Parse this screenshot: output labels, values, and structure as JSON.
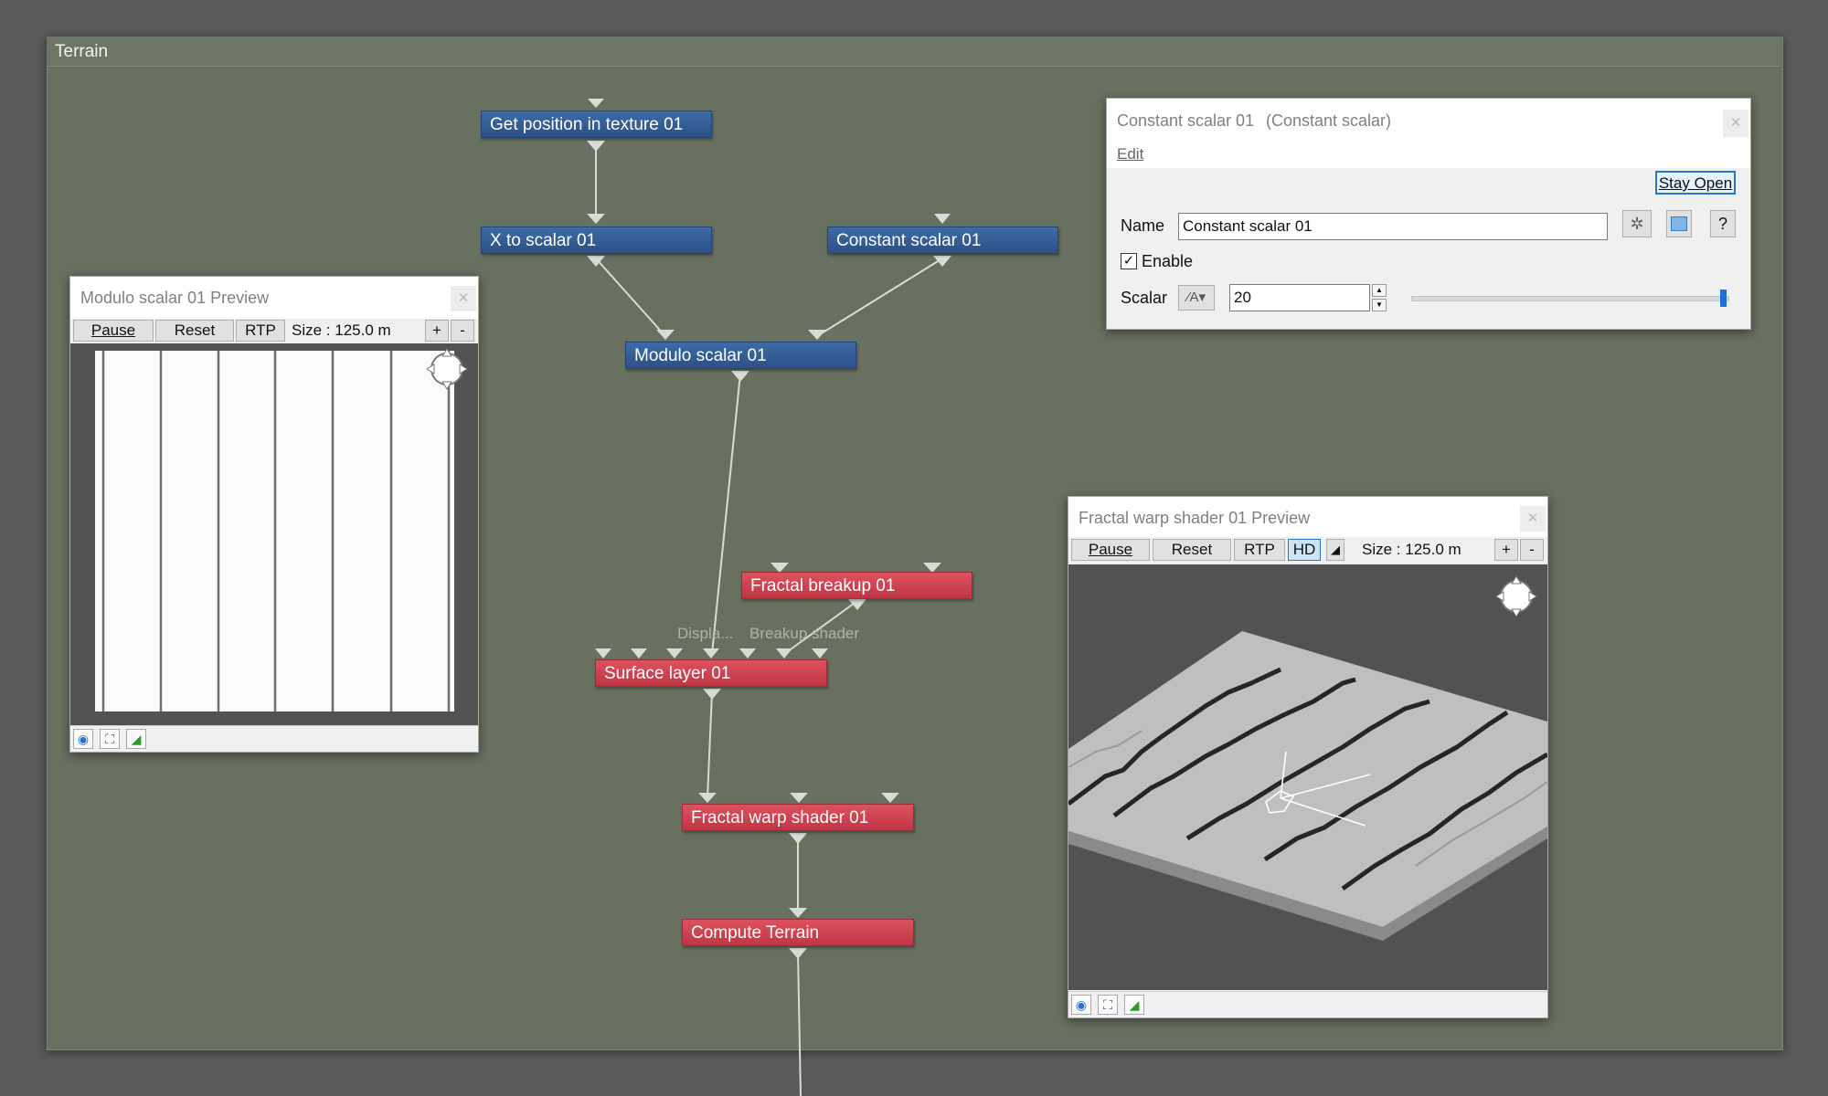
{
  "panel": {
    "title": "Terrain"
  },
  "nodes": {
    "get_position": "Get position in texture 01",
    "x_to_scalar": "X to scalar 01",
    "constant_scalar": "Constant scalar 01",
    "modulo_scalar": "Modulo scalar 01",
    "fractal_breakup": "Fractal breakup 01",
    "surface_layer": "Surface layer 01",
    "fractal_warp": "Fractal warp shader 01",
    "compute_terrain": "Compute Terrain"
  },
  "port_labels": {
    "displacement": "Displa...",
    "breakup_shader": "Breakup shader"
  },
  "modulo_preview": {
    "title": "Modulo scalar 01 Preview",
    "pause": "Pause",
    "reset": "Reset",
    "rtp": "RTP",
    "size_label": "Size : 125.0 m",
    "plus": "+",
    "minus": "-"
  },
  "fractal_preview": {
    "title": "Fractal warp shader 01 Preview",
    "pause": "Pause",
    "reset": "Reset",
    "rtp": "RTP",
    "hd": "HD",
    "size_label": "Size : 125.0 m",
    "plus": "+",
    "minus": "-"
  },
  "props": {
    "title": "Constant scalar 01",
    "subtitle": "(Constant scalar)",
    "menu_edit": "Edit",
    "stay_open": "Stay Open",
    "name_label": "Name",
    "name_value": "Constant scalar 01",
    "enable_label": "Enable",
    "enable_checked": true,
    "scalar_label": "Scalar",
    "scalar_value": "20",
    "help": "?",
    "slider_level": 1.0
  },
  "colors": {
    "node_blue": "#2f5a93",
    "node_red": "#cc3f4d",
    "canvas": "#687060"
  }
}
